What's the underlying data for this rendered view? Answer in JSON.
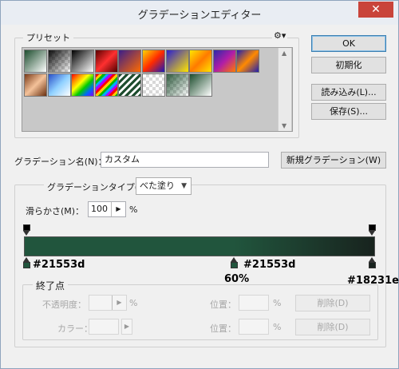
{
  "window": {
    "title": "グラデーションエディター",
    "close": "✕"
  },
  "presets": {
    "legend": "プリセット",
    "gear": "⚙▾",
    "swatches": [
      {
        "bg": "linear-gradient(135deg,#1d4d2e,#ffffff)"
      },
      {
        "bg": "checker-black"
      },
      {
        "bg": "linear-gradient(135deg,#000000,#ffffff)"
      },
      {
        "bg": "linear-gradient(135deg,#5a0000,#ff3030,#500000)"
      },
      {
        "bg": "linear-gradient(135deg,#3a1e8a,#ff6a00)"
      },
      {
        "bg": "linear-gradient(135deg,#ffd400,#ff2a00,#1a18b8)"
      },
      {
        "bg": "linear-gradient(135deg,#2b1fd0,#ffe600)"
      },
      {
        "bg": "linear-gradient(135deg,#ffe600,#ff7a00,#ffe600)"
      },
      {
        "bg": "linear-gradient(135deg,#2b2aa8,#b01da8,#ff7a00)"
      },
      {
        "bg": "linear-gradient(135deg,#1f1fb0,#ff8a00,#1f1fb0)"
      },
      {
        "bg": "linear-gradient(135deg,#7a3a18,#f4c29a,#6a3010)"
      },
      {
        "bg": "linear-gradient(135deg,#2a50c8,#8fd0ff,#ffffff)"
      },
      {
        "bg": "linear-gradient(135deg,#ff0000,#ff8800,#ffff00,#00cc00,#0066ff,#8800ff)"
      },
      {
        "bg": "repeating-linear-gradient(135deg,#ff0000 0 3px,#ffcc00 3px 6px,#00bb00 6px 9px,#00aaff 9px 12px,#aa00ff 12px 15px)"
      },
      {
        "bg": "repeating-linear-gradient(135deg,#1d4d2e 0 3px,#ffffff 3px 6px)"
      },
      {
        "bg": "checker"
      },
      {
        "bg": "checker-light"
      },
      {
        "bg": "linear-gradient(135deg,#1d4d2e,#ffffff)"
      }
    ]
  },
  "buttons": {
    "ok": "OK",
    "reset": "初期化",
    "load": "読み込み(L)...",
    "save": "保存(S)...",
    "new_gradient": "新規グラデーション(W)"
  },
  "name_field": {
    "label": "グラデーション名(N)：",
    "value": "カスタム"
  },
  "type_group": {
    "type_label": "グラデーションタイプ(T)：",
    "type_value": "べた塗り",
    "smooth_label": "滑らかさ(M)：",
    "smooth_value": "100",
    "smooth_unit": "%"
  },
  "gradient": {
    "stops": [
      {
        "color": "#21553d",
        "location": 0,
        "label": "#21553d"
      },
      {
        "color": "#21553d",
        "location": 60,
        "label": "#21553d",
        "position_label": "60%"
      },
      {
        "color": "#18231e",
        "location": 100,
        "label": "#18231e"
      }
    ],
    "opacity_stops": [
      {
        "location": 0
      },
      {
        "location": 100
      }
    ]
  },
  "stops_group": {
    "legend": "終了点",
    "opacity_label": "不透明度：",
    "opacity_unit": "%",
    "location_label1": "位置：",
    "location_unit1": "%",
    "delete1": "削除(D)",
    "color_label": "カラー：",
    "location_label2": "位置：",
    "location_unit2": "%",
    "delete2": "削除(D)"
  }
}
